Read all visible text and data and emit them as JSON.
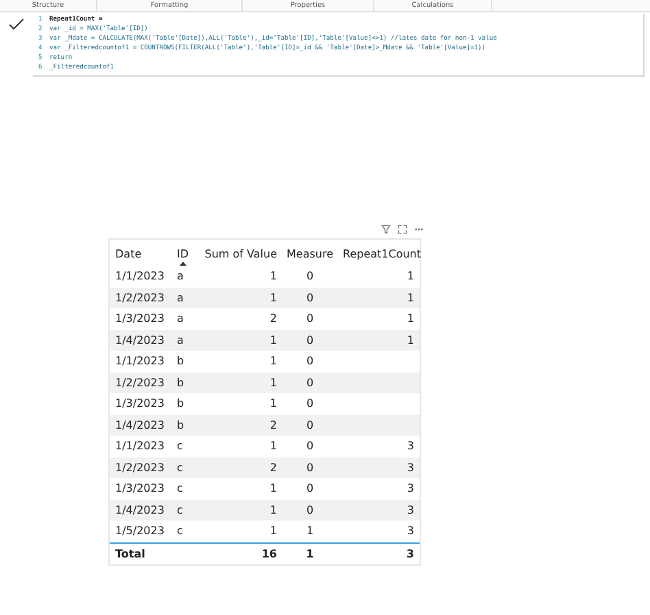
{
  "ribbon": {
    "sections": [
      "Structure",
      "Formatting",
      "Properties",
      "Calculations"
    ]
  },
  "formula_bar": {
    "lines": [
      {
        "number": "1",
        "code": "Repeat1Count ="
      },
      {
        "number": "2",
        "code": "var _id = MAX('Table'[ID])"
      },
      {
        "number": "3",
        "code": "var _Mdate = CALCULATE(MAX('Table'[Date]),ALL('Table'),_id='Table'[ID],'Table'[Value]<>1) //lates date for non-1 value"
      },
      {
        "number": "4",
        "code": "var _Filteredcountof1 = COUNTROWS(FILTER(ALL('Table'),'Table'[ID]=_id && 'Table'[Date]>_Mdate && 'Table'[Value]=1))"
      },
      {
        "number": "5",
        "code": "return"
      },
      {
        "number": "6",
        "code": "_Filteredcountof1"
      }
    ]
  },
  "table": {
    "columns": [
      {
        "label": "Date",
        "sorted": false
      },
      {
        "label": "ID",
        "sorted": true
      },
      {
        "label": "Sum of Value",
        "sorted": false
      },
      {
        "label": "Measure",
        "sorted": false
      },
      {
        "label": "Repeat1Count",
        "sorted": false
      }
    ],
    "rows": [
      [
        "1/1/2023",
        "a",
        "1",
        "0",
        "1"
      ],
      [
        "1/2/2023",
        "a",
        "1",
        "0",
        "1"
      ],
      [
        "1/3/2023",
        "a",
        "2",
        "0",
        "1"
      ],
      [
        "1/4/2023",
        "a",
        "1",
        "0",
        "1"
      ],
      [
        "1/1/2023",
        "b",
        "1",
        "0",
        null
      ],
      [
        "1/2/2023",
        "b",
        "1",
        "0",
        null
      ],
      [
        "1/3/2023",
        "b",
        "1",
        "0",
        null
      ],
      [
        "1/4/2023",
        "b",
        "2",
        "0",
        null
      ],
      [
        "1/1/2023",
        "c",
        "1",
        "0",
        "3"
      ],
      [
        "1/2/2023",
        "c",
        "2",
        "0",
        "3"
      ],
      [
        "1/3/2023",
        "c",
        "1",
        "0",
        "3"
      ],
      [
        "1/4/2023",
        "c",
        "1",
        "0",
        "3"
      ],
      [
        "1/5/2023",
        "c",
        "1",
        "1",
        "3"
      ]
    ],
    "total": {
      "label": "Total",
      "values": [
        "16",
        "1",
        "3"
      ]
    }
  }
}
